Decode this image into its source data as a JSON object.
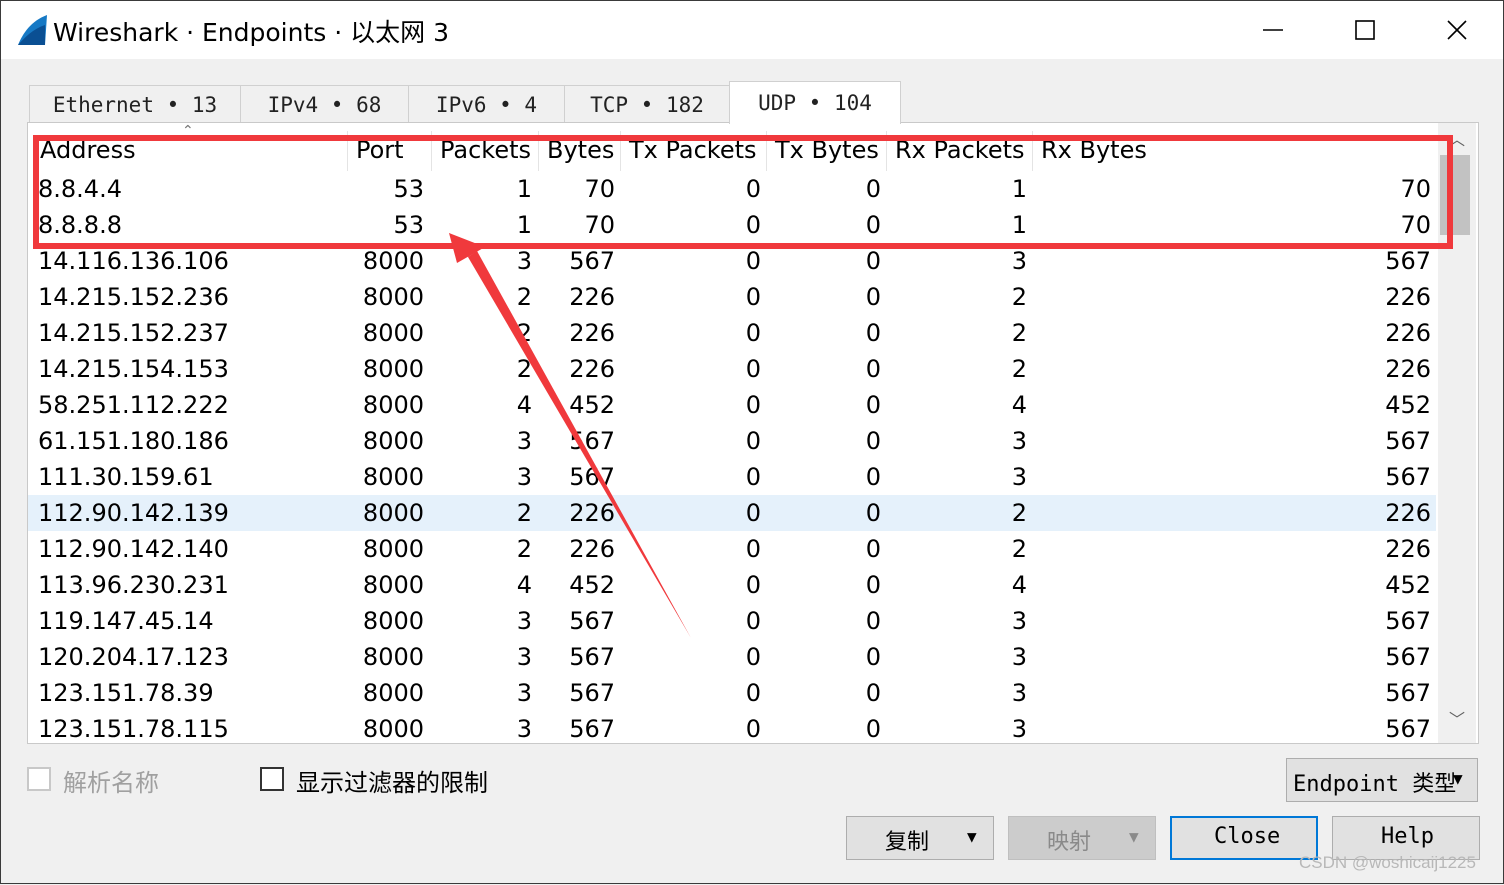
{
  "window": {
    "title": "Wireshark · Endpoints · 以太网 3"
  },
  "tabs": [
    {
      "label": "Ethernet  •  13",
      "active": false
    },
    {
      "label": "IPv4  •  68",
      "active": false
    },
    {
      "label": "IPv6  •  4",
      "active": false
    },
    {
      "label": "TCP  •  182",
      "active": false
    },
    {
      "label": "UDP  •  104",
      "active": true
    }
  ],
  "table": {
    "columns": [
      "Address",
      "Port",
      "Packets",
      "Bytes",
      "Tx Packets",
      "Tx Bytes",
      "Rx Packets",
      "Rx Bytes"
    ],
    "rows": [
      [
        "8.8.4.4",
        "53",
        "1",
        "70",
        "0",
        "0",
        "1",
        "70"
      ],
      [
        "8.8.8.8",
        "53",
        "1",
        "70",
        "0",
        "0",
        "1",
        "70"
      ],
      [
        "14.116.136.106",
        "8000",
        "3",
        "567",
        "0",
        "0",
        "3",
        "567"
      ],
      [
        "14.215.152.236",
        "8000",
        "2",
        "226",
        "0",
        "0",
        "2",
        "226"
      ],
      [
        "14.215.152.237",
        "8000",
        "2",
        "226",
        "0",
        "0",
        "2",
        "226"
      ],
      [
        "14.215.154.153",
        "8000",
        "2",
        "226",
        "0",
        "0",
        "2",
        "226"
      ],
      [
        "58.251.112.222",
        "8000",
        "4",
        "452",
        "0",
        "0",
        "4",
        "452"
      ],
      [
        "61.151.180.186",
        "8000",
        "3",
        "567",
        "0",
        "0",
        "3",
        "567"
      ],
      [
        "111.30.159.61",
        "8000",
        "3",
        "567",
        "0",
        "0",
        "3",
        "567"
      ],
      [
        "112.90.142.139",
        "8000",
        "2",
        "226",
        "0",
        "0",
        "2",
        "226"
      ],
      [
        "112.90.142.140",
        "8000",
        "2",
        "226",
        "0",
        "0",
        "2",
        "226"
      ],
      [
        "113.96.230.231",
        "8000",
        "4",
        "452",
        "0",
        "0",
        "4",
        "452"
      ],
      [
        "119.147.45.14",
        "8000",
        "3",
        "567",
        "0",
        "0",
        "3",
        "567"
      ],
      [
        "120.204.17.123",
        "8000",
        "3",
        "567",
        "0",
        "0",
        "3",
        "567"
      ],
      [
        "123.151.78.39",
        "8000",
        "3",
        "567",
        "0",
        "0",
        "3",
        "567"
      ],
      [
        "123.151.78.115",
        "8000",
        "3",
        "567",
        "0",
        "0",
        "3",
        "567"
      ]
    ],
    "selected_row_address": "112.90.142.139"
  },
  "options": {
    "resolve_names_label": "解析名称",
    "resolve_names_checked": false,
    "resolve_names_enabled": false,
    "limit_filter_label": "显示过滤器的限制",
    "limit_filter_checked": false
  },
  "buttons": {
    "endpoint_type": "Endpoint 类型",
    "copy": "复制",
    "map": "映射",
    "close": "Close",
    "help": "Help"
  },
  "watermark": "CSDN @woshicaij1225",
  "colors": {
    "annotation": "#f0393c",
    "selection": "#e5f1fb",
    "focus": "#0078d7"
  }
}
